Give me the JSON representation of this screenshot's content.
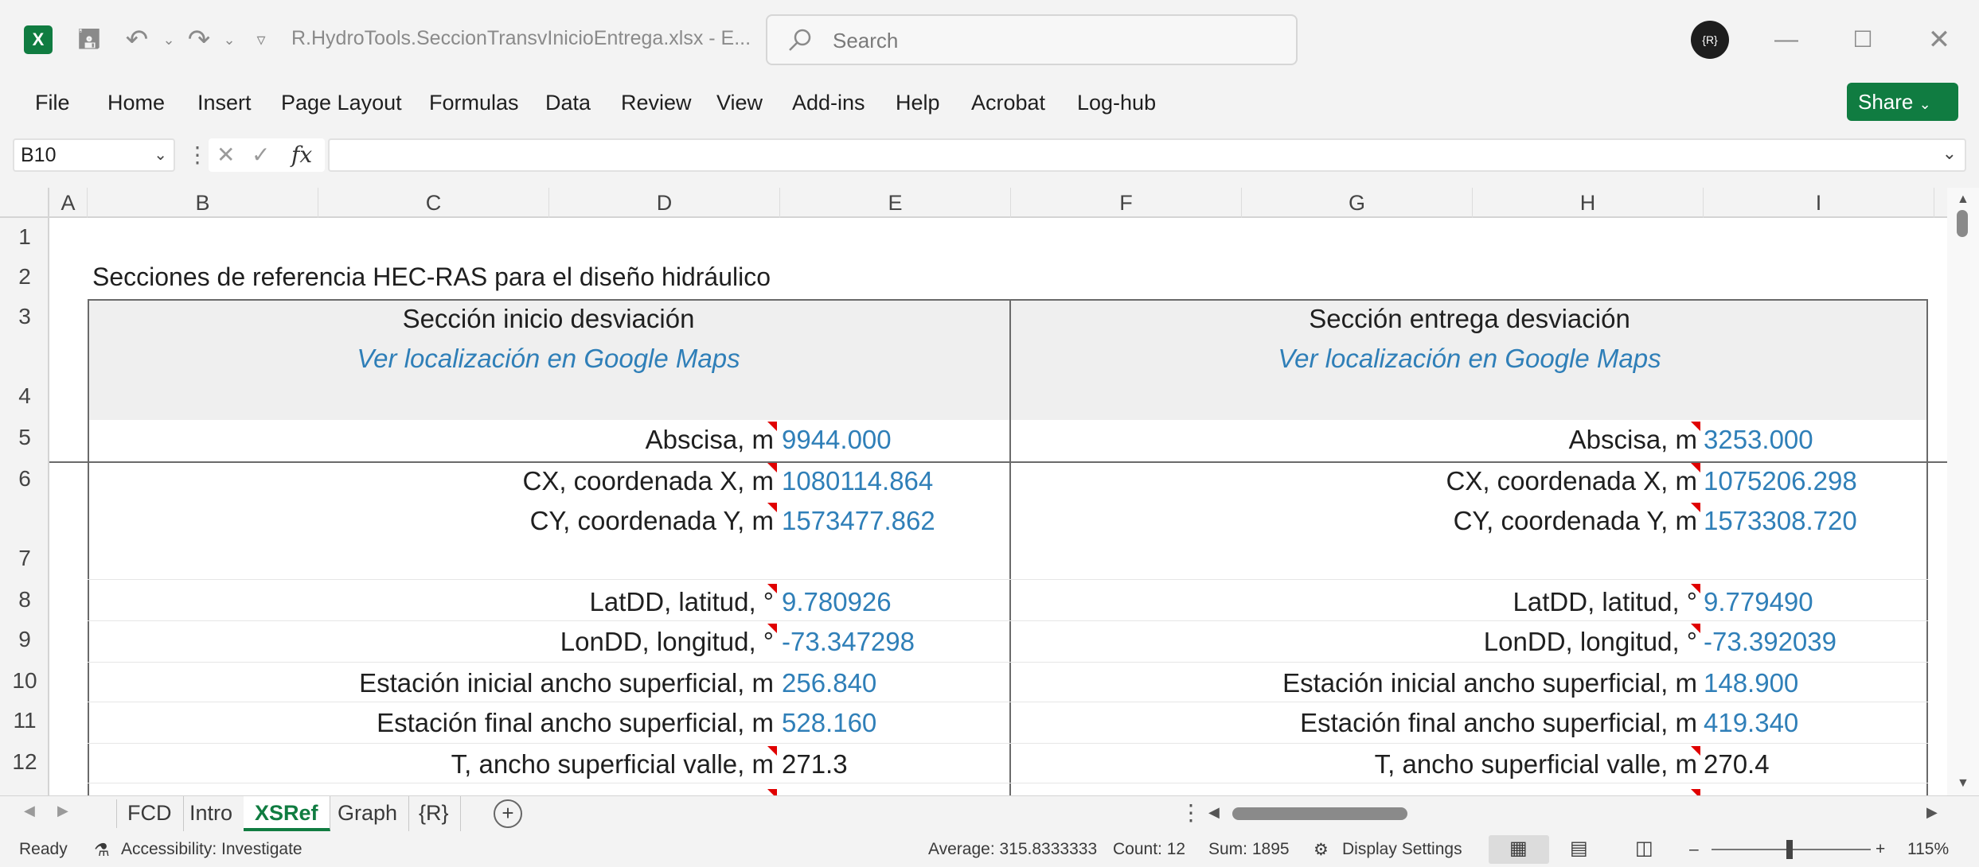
{
  "window": {
    "app_icon": "X",
    "document_title": "R.HydroTools.SeccionTransvInicioEntrega.xlsx  -  E...",
    "search_placeholder": "Search",
    "avatar_text": "{R}"
  },
  "ribbon": {
    "tabs": [
      "File",
      "Home",
      "Insert",
      "Page Layout",
      "Formulas",
      "Data",
      "Review",
      "View",
      "Add-ins",
      "Help",
      "Acrobat",
      "Log-hub"
    ],
    "share_label": "Share"
  },
  "formula_bar": {
    "name_box": "B10",
    "fx_label": "fx",
    "content": ""
  },
  "grid": {
    "columns": [
      "A",
      "B",
      "C",
      "D",
      "E",
      "F",
      "G",
      "H",
      "I"
    ],
    "rows": [
      "1",
      "2",
      "3",
      "4",
      "5",
      "6",
      "7",
      "8",
      "9",
      "10",
      "11",
      "12"
    ],
    "sheet_title": "Secciones de referencia HEC-RAS para el diseño hidráulico",
    "left": {
      "header": "Sección inicio desviación",
      "link": "Ver localización en Google Maps",
      "abscisa_label": "Abscisa, m",
      "abscisa": "9944.000",
      "cx_label": "CX, coordenada X, m",
      "cx": "1080114.864",
      "cy_label": "CY, coordenada Y, m",
      "cy": "1573477.862",
      "lat_label": "LatDD, latitud, °",
      "lat": "9.780926",
      "lon_label": "LonDD, longitud, °",
      "lon": "-73.347298",
      "est_ini_label": "Estación inicial ancho superficial, m",
      "est_ini": "256.840",
      "est_fin_label": "Estación final ancho superficial, m",
      "est_fin": "528.160",
      "t_label": "T, ancho superficial valle, m",
      "t": "271.3"
    },
    "right": {
      "header": "Sección entrega desviación",
      "link": "Ver localización en Google Maps",
      "abscisa_label": "Abscisa, m",
      "abscisa": "3253.000",
      "cx_label": "CX, coordenada X, m",
      "cx": "1075206.298",
      "cy_label": "CY, coordenada Y, m",
      "cy": "1573308.720",
      "lat_label": "LatDD, latitud, °",
      "lat": "9.779490",
      "lon_label": "LonDD, longitud, °",
      "lon": "-73.392039",
      "est_ini_label": "Estación inicial ancho superficial, m",
      "est_ini": "148.900",
      "est_fin_label": "Estación final ancho superficial, m",
      "est_fin": "419.340",
      "t_label": "T, ancho superficial valle, m",
      "t": "270.4"
    }
  },
  "sheet_tabs": [
    "FCD",
    "Intro",
    "XSRef",
    "Graph",
    "{R}"
  ],
  "active_sheet": "XSRef",
  "status": {
    "ready": "Ready",
    "accessibility": "Accessibility: Investigate",
    "average": "Average: 315.8333333",
    "count": "Count: 12",
    "sum": "Sum: 1895",
    "display_settings": "Display Settings",
    "zoom": "115%"
  },
  "colors": {
    "excel_green": "#107c41",
    "link_blue": "#2f7fb8",
    "comment_red": "#e00000"
  }
}
